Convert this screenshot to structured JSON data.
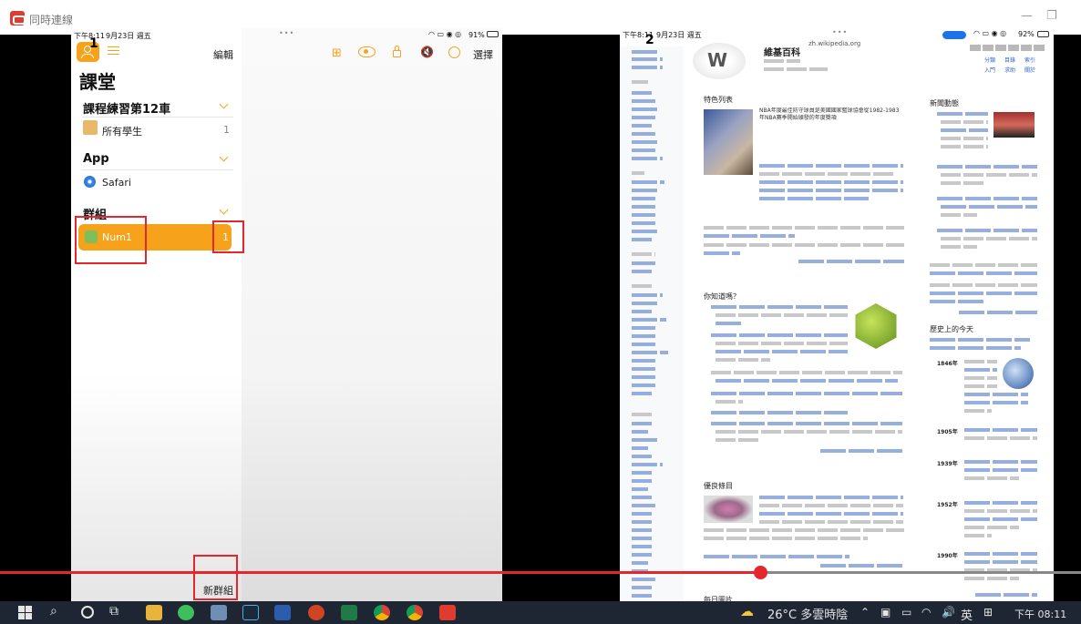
{
  "window": {
    "title": "同時連線"
  },
  "left_ipad": {
    "status_time": "下午8:11",
    "status_date": "9月23日 週五",
    "status_battery": "91%",
    "toolbar": {
      "edit_label": "編輯",
      "select_label": "選擇"
    },
    "page_title": "課堂",
    "section_class": {
      "title": "課程練習第12車",
      "items": [
        {
          "label": "所有學生",
          "count": "1"
        }
      ]
    },
    "section_app": {
      "title": "App",
      "items": [
        {
          "label": "Safari"
        }
      ]
    },
    "section_groups": {
      "title": "群組",
      "items": [
        {
          "label": "Num1",
          "count": "1"
        }
      ]
    },
    "new_group_label": "新群組"
  },
  "right_ipad": {
    "status_time": "下午8:11",
    "status_date": "9月23日 週五",
    "status_battery": "92%",
    "url": "zh.wikipedia.org",
    "site_title": "維基百科",
    "nav_links": [
      "分類",
      "目錄",
      "索引",
      "入門",
      "求助",
      "關於"
    ],
    "sections": {
      "featured": "特色列表",
      "did_you_know": "你知道嗎？",
      "good_article": "優良條目",
      "news": "新聞動態",
      "on_this_day": "歷史上的今天",
      "featured_picture": "每日圖片"
    },
    "featured_text": "NBA年度最佳防守球員是美國國家籃球協會從1982-1983年NBA賽季開始頒發的年度獎項",
    "otd_years": [
      "1846年",
      "1905年",
      "1939年",
      "1952年",
      "1990年"
    ]
  },
  "labels": {
    "num1": "1",
    "num2": "2"
  },
  "progress": {
    "fraction": 0.703
  },
  "taskbar": {
    "weather": "26°C 多雲時陰",
    "ime": "英",
    "clock": "下午 08:11"
  }
}
